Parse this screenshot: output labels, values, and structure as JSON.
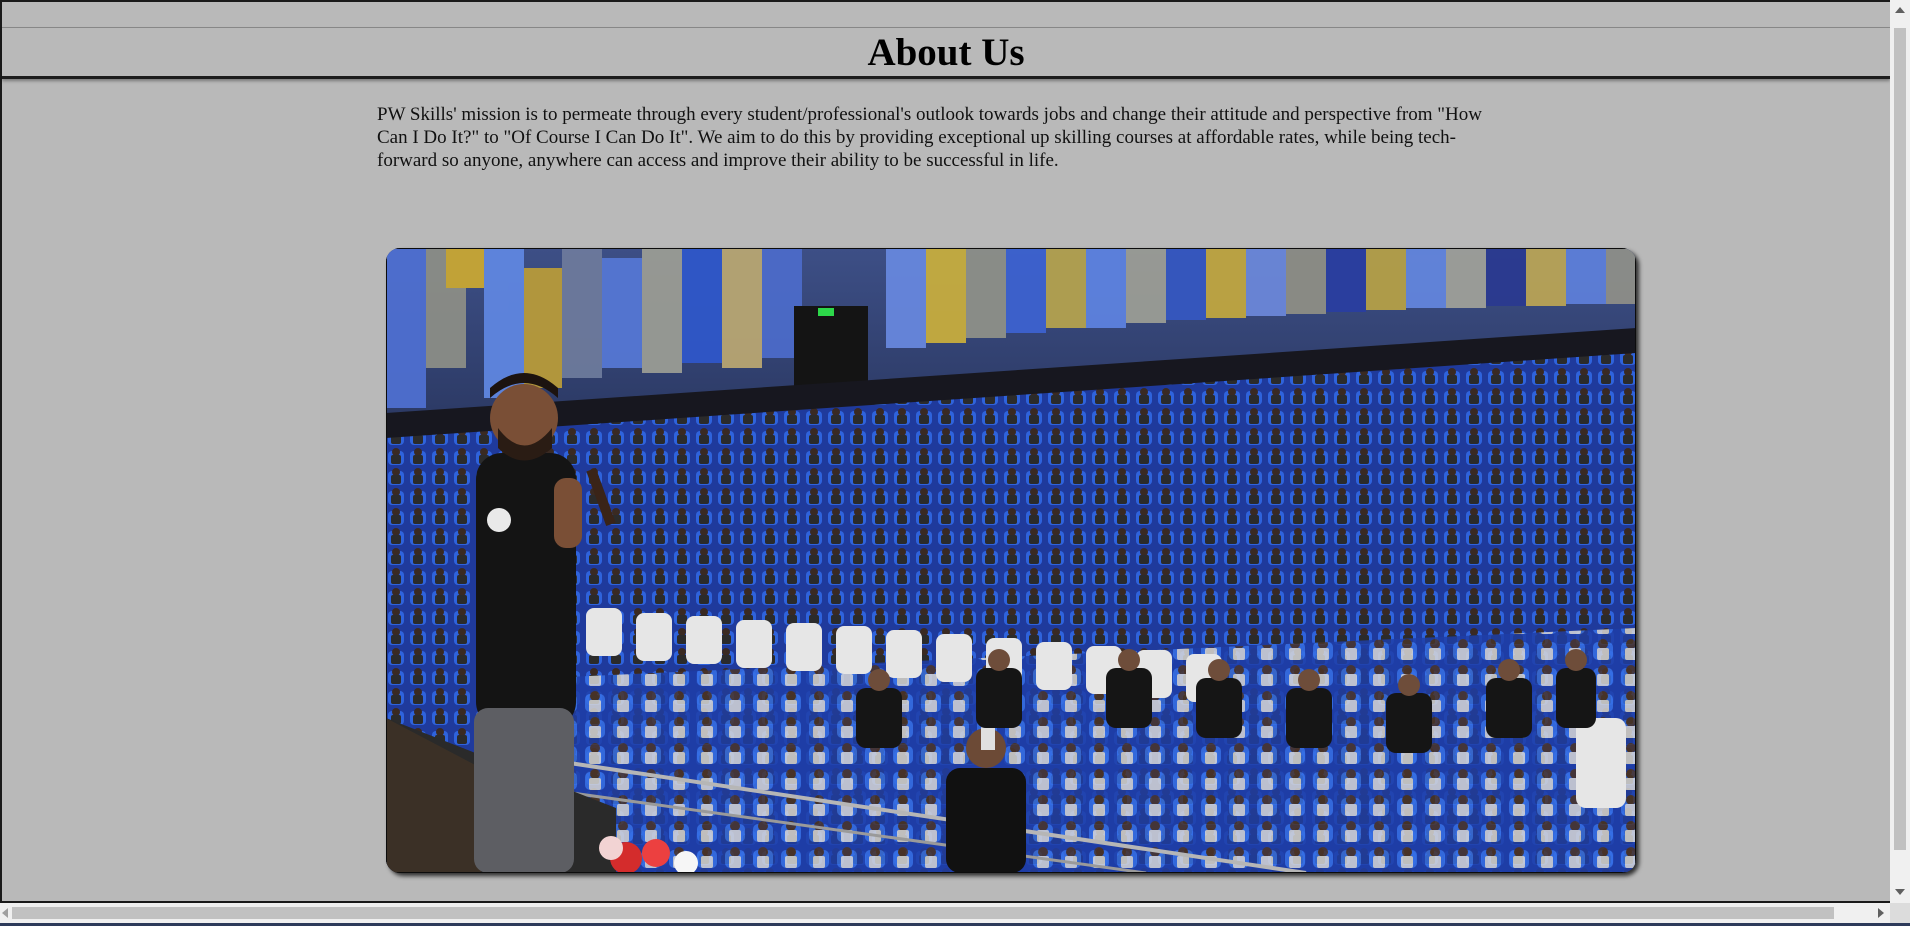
{
  "header": {
    "title": "About Us"
  },
  "about": {
    "mission_text": "PW Skills' mission is to permeate through every student/professional's outlook towards jobs and change their attitude and perspective from \"How Can I Do It?\" to \"Of Course I Can Do It\". We aim to do this by providing exceptional up skilling courses at affordable rates, while being tech-forward so anyone, anywhere can access and improve their ability to be successful in life."
  },
  "photo": {
    "subject": "speaker addressing a seated audience in an auditorium"
  },
  "scrollbars": {
    "vertical_icon_up": "chevron-up-icon",
    "vertical_icon_down": "chevron-down-icon",
    "horizontal_icon_left": "chevron-left-icon",
    "horizontal_icon_right": "chevron-right-icon"
  },
  "colors": {
    "page_background": "#b9b9b9",
    "header_rule": "#1d1d1d",
    "seat_blue": "#2a5bd7"
  }
}
